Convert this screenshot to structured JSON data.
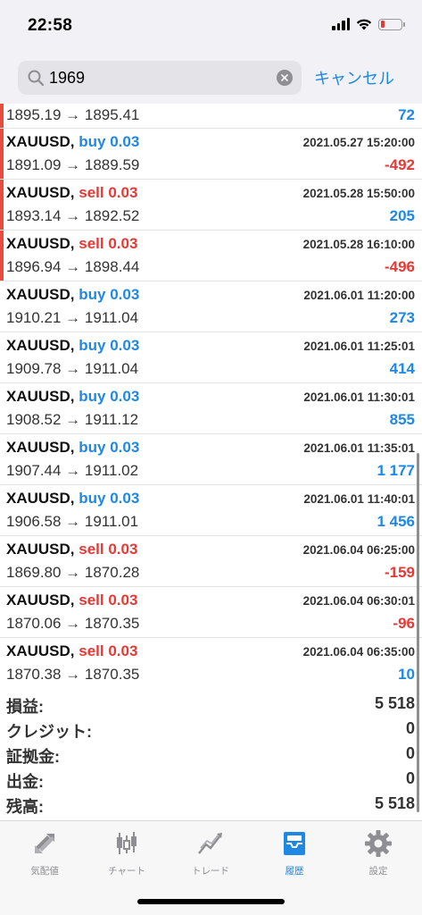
{
  "status": {
    "time": "22:58"
  },
  "search": {
    "query": "1969",
    "cancel_label": "キャンセル"
  },
  "first_row": {
    "prices": "1895.19 → 1895.41",
    "profit": "72"
  },
  "trades": [
    {
      "symbol": "XAUUSD,",
      "side": "buy",
      "volume": "0.03",
      "datetime": "2021.05.27 15:20:00",
      "prices": "1891.09 → 1889.59",
      "profit": "-492"
    },
    {
      "symbol": "XAUUSD,",
      "side": "sell",
      "volume": "0.03",
      "datetime": "2021.05.28 15:50:00",
      "prices": "1893.14 → 1892.52",
      "profit": "205"
    },
    {
      "symbol": "XAUUSD,",
      "side": "sell",
      "volume": "0.03",
      "datetime": "2021.05.28 16:10:00",
      "prices": "1896.94 → 1898.44",
      "profit": "-496"
    },
    {
      "symbol": "XAUUSD,",
      "side": "buy",
      "volume": "0.03",
      "datetime": "2021.06.01 11:20:00",
      "prices": "1910.21 → 1911.04",
      "profit": "273"
    },
    {
      "symbol": "XAUUSD,",
      "side": "buy",
      "volume": "0.03",
      "datetime": "2021.06.01 11:25:01",
      "prices": "1909.78 → 1911.04",
      "profit": "414"
    },
    {
      "symbol": "XAUUSD,",
      "side": "buy",
      "volume": "0.03",
      "datetime": "2021.06.01 11:30:01",
      "prices": "1908.52 → 1911.12",
      "profit": "855"
    },
    {
      "symbol": "XAUUSD,",
      "side": "buy",
      "volume": "0.03",
      "datetime": "2021.06.01 11:35:01",
      "prices": "1907.44 → 1911.02",
      "profit": "1 177"
    },
    {
      "symbol": "XAUUSD,",
      "side": "buy",
      "volume": "0.03",
      "datetime": "2021.06.01 11:40:01",
      "prices": "1906.58 → 1911.01",
      "profit": "1 456"
    },
    {
      "symbol": "XAUUSD,",
      "side": "sell",
      "volume": "0.03",
      "datetime": "2021.06.04 06:25:00",
      "prices": "1869.80 → 1870.28",
      "profit": "-159"
    },
    {
      "symbol": "XAUUSD,",
      "side": "sell",
      "volume": "0.03",
      "datetime": "2021.06.04 06:30:01",
      "prices": "1870.06 → 1870.35",
      "profit": "-96"
    },
    {
      "symbol": "XAUUSD,",
      "side": "sell",
      "volume": "0.03",
      "datetime": "2021.06.04 06:35:00",
      "prices": "1870.38 → 1870.35",
      "profit": "10"
    }
  ],
  "summary": [
    {
      "label": "損益:",
      "value": "5 518"
    },
    {
      "label": "クレジット:",
      "value": "0"
    },
    {
      "label": "証拠金:",
      "value": "0"
    },
    {
      "label": "出金:",
      "value": "0"
    },
    {
      "label": "残高:",
      "value": "5 518"
    }
  ],
  "tabs": [
    {
      "label": "気配値",
      "icon": "quotes-icon"
    },
    {
      "label": "チャート",
      "icon": "chart-icon"
    },
    {
      "label": "トレード",
      "icon": "trade-icon"
    },
    {
      "label": "履歴",
      "icon": "history-icon"
    },
    {
      "label": "設定",
      "icon": "gear-icon"
    }
  ],
  "colors": {
    "buy": "#1e88e5",
    "sell": "#e53935",
    "accent": "#1e88e5"
  }
}
